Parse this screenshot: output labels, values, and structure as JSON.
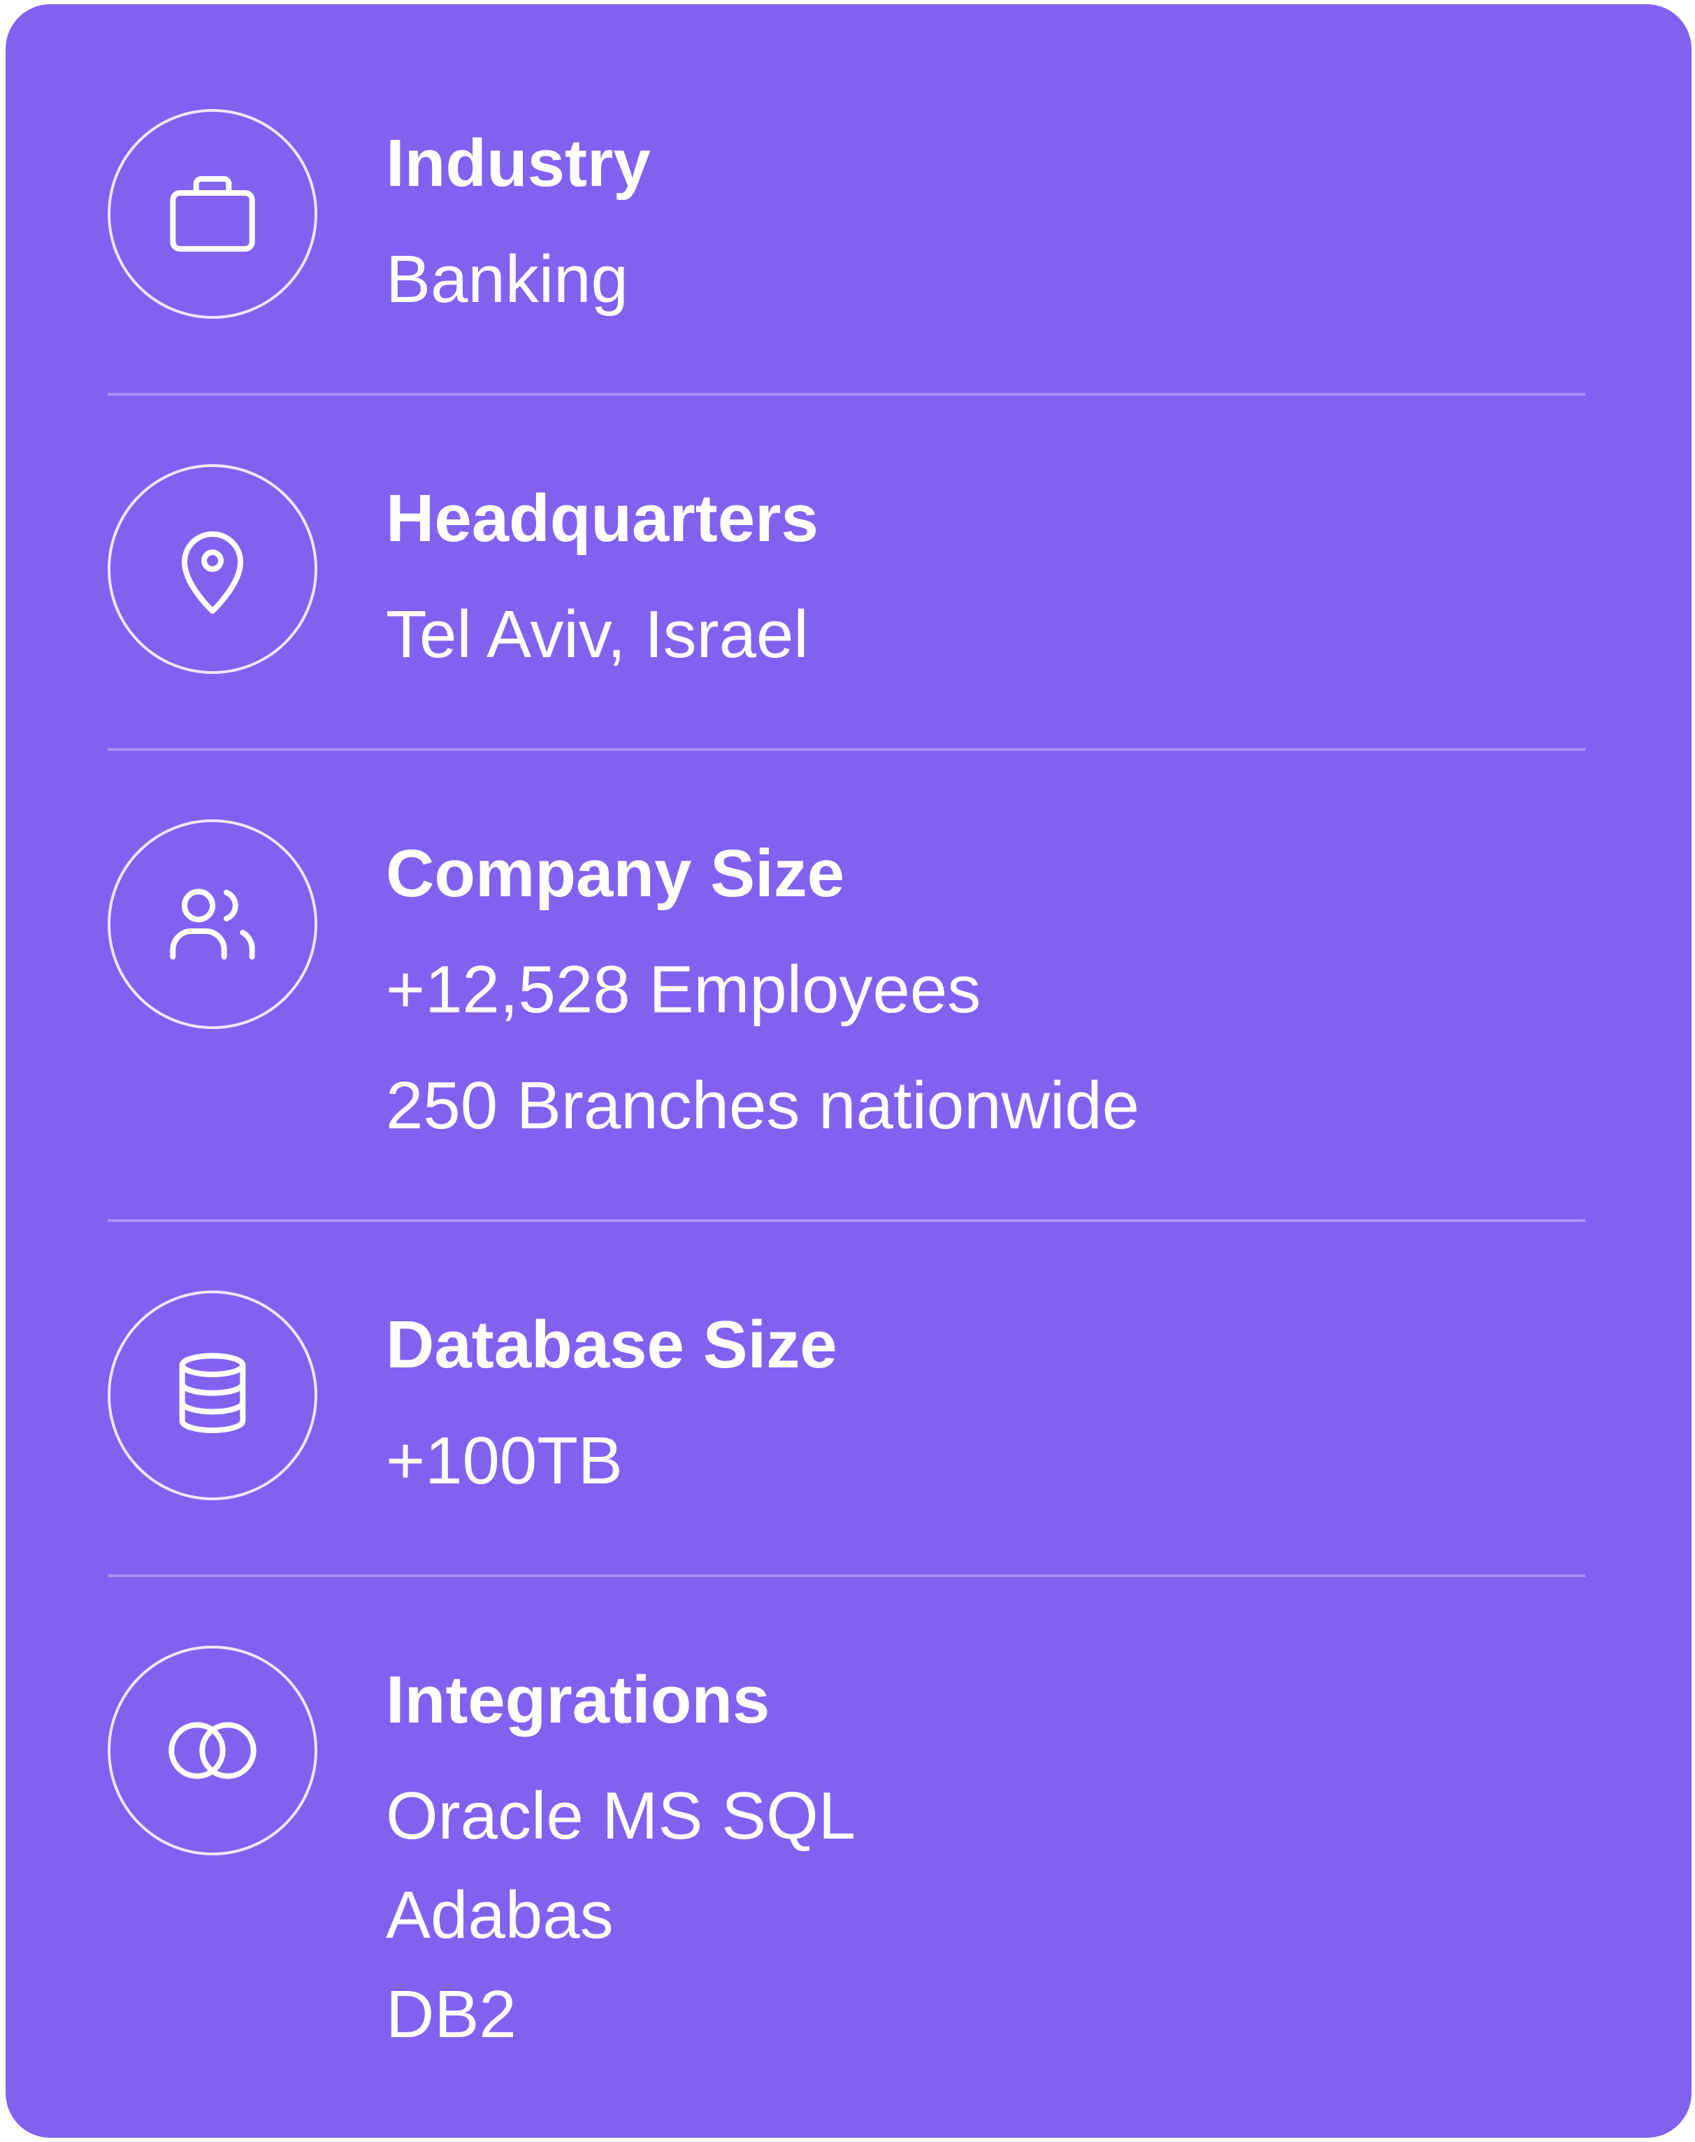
{
  "card": {
    "background": "#8062F0",
    "rows": [
      {
        "icon": "briefcase-icon",
        "label": "Industry",
        "values": [
          "Banking"
        ]
      },
      {
        "icon": "map-pin-icon",
        "label": "Headquarters",
        "values": [
          "Tel Aviv, Israel"
        ]
      },
      {
        "icon": "users-icon",
        "label": "Company Size",
        "values": [
          "+12,528 Employees",
          "250 Branches nationwide"
        ]
      },
      {
        "icon": "database-icon",
        "label": "Database Size",
        "values": [
          "+100TB"
        ]
      },
      {
        "icon": "integrations-icon",
        "label": "Integrations",
        "values": [
          "Oracle MS SQL",
          "Adabas",
          "DB2"
        ]
      }
    ]
  }
}
